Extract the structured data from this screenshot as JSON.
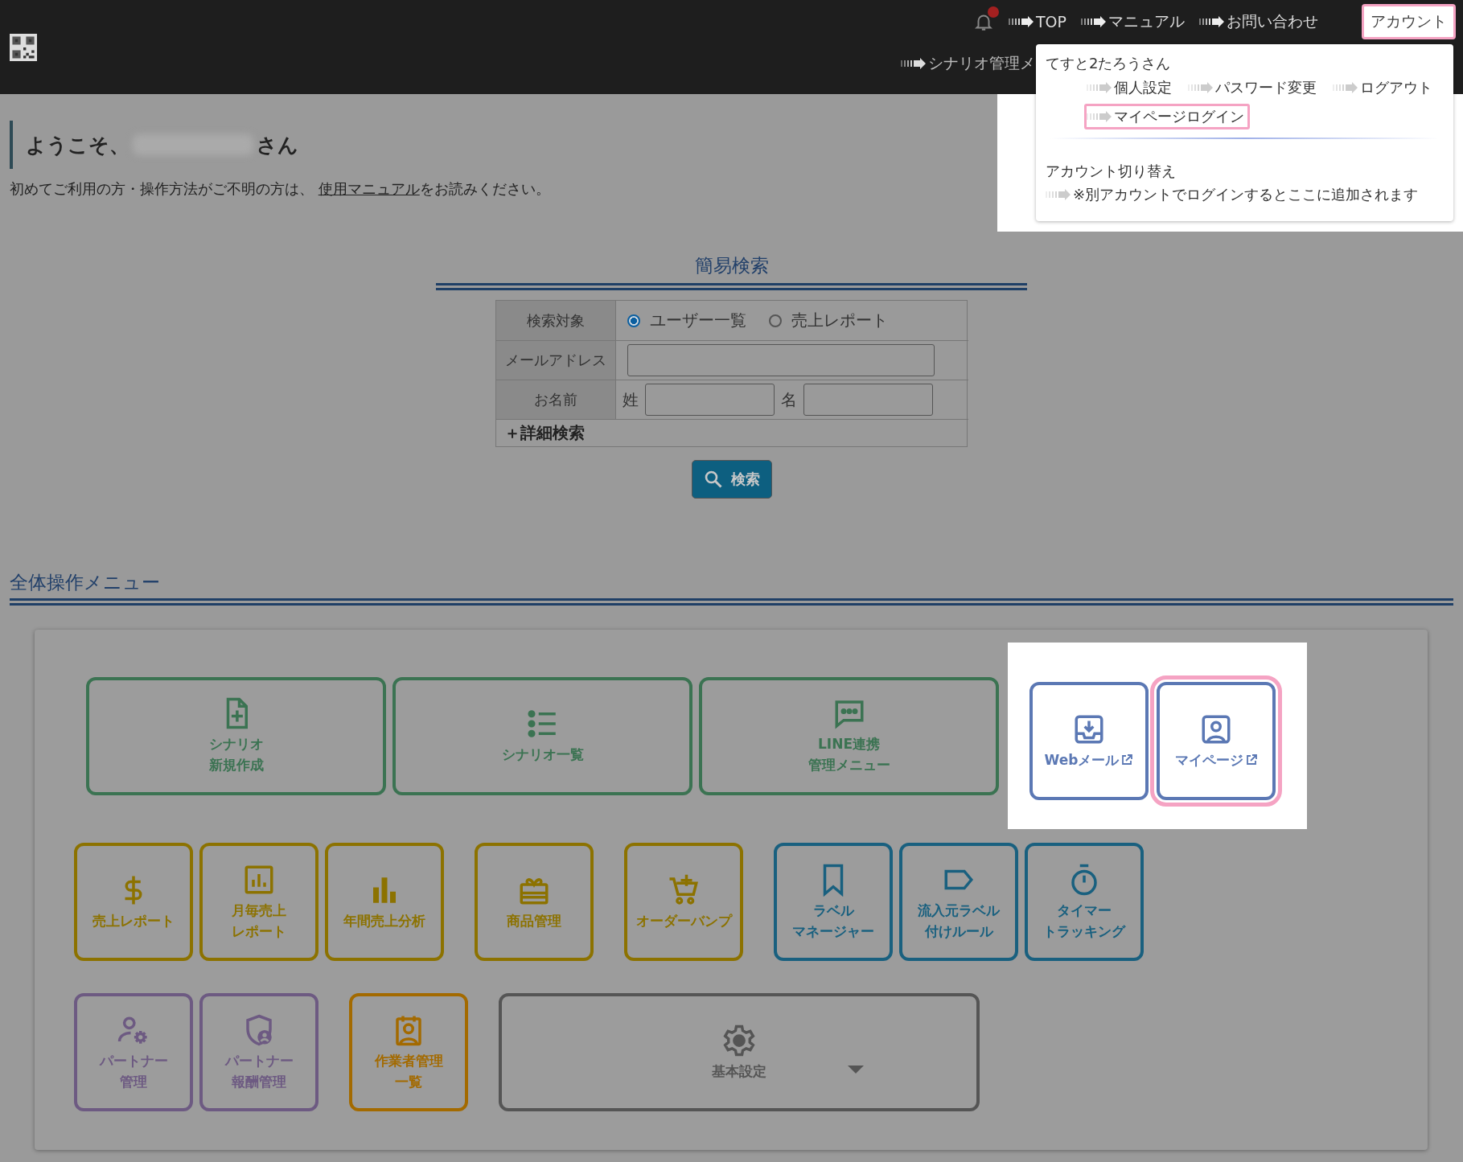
{
  "header": {
    "notification": {
      "unread": true
    },
    "nav": [
      {
        "label": "TOP"
      },
      {
        "label": "マニュアル"
      },
      {
        "label": "お問い合わせ"
      }
    ],
    "account_button": {
      "label": "アカウント",
      "highlighted": true
    },
    "sub_nav": [
      {
        "label": "シナリオ管理メ"
      }
    ]
  },
  "account_menu": {
    "user": "てすと2たろうさん",
    "links": [
      {
        "label": "個人設定",
        "highlighted": false
      },
      {
        "label": "パスワード変更",
        "highlighted": false
      },
      {
        "label": "ログアウト",
        "highlighted": false
      },
      {
        "label": "マイページログイン",
        "highlighted": true
      }
    ],
    "switch_title": "アカウント切り替え",
    "switch_note": "※別アカウントでログインするとここに追加されます"
  },
  "welcome": {
    "greeting": "ようこそ、",
    "suffix": "さん",
    "intro": "初めてご利用の方・操作方法がご不明の方は、",
    "intro_link": "使用マニュアル",
    "intro_end": "をお読みください。"
  },
  "search": {
    "title": "簡易検索",
    "target_label": "検索対象",
    "options": [
      {
        "label": "ユーザー一覧",
        "selected": true
      },
      {
        "label": "売上レポート",
        "selected": false
      }
    ],
    "email_label": "メールアドレス",
    "name_label": "お名前",
    "last_name_label": "姓",
    "first_name_label": "名",
    "advanced": "＋詳細検索",
    "button": "検索"
  },
  "menu": {
    "title": "全体操作メニュー",
    "rows": [
      {
        "groups": [
          {
            "color": "#3b7352",
            "spotlight": false,
            "tiles": [
              {
                "kind": "large",
                "lines": [
                  "シナリオ",
                  "新規作成"
                ]
              },
              {
                "kind": "large",
                "lines": [
                  "シナリオ一覧"
                ]
              },
              {
                "kind": "large",
                "lines": [
                  "LINE連携",
                  "管理メニュー"
                ]
              }
            ]
          },
          {
            "color": "#5b78b4",
            "spotlight": true,
            "tiles": [
              {
                "kind": "small",
                "lines": [
                  "Webメール"
                ],
                "external": true,
                "highlighted": false
              },
              {
                "kind": "small",
                "lines": [
                  "マイページ"
                ],
                "external": true,
                "highlighted": true
              }
            ]
          }
        ]
      },
      {
        "groups": [
          {
            "color": "#8c7200",
            "spotlight": false,
            "tiles": [
              {
                "kind": "small",
                "lines": [
                  "売上レポート"
                ]
              },
              {
                "kind": "small",
                "lines": [
                  "月毎売上",
                  "レポート"
                ]
              },
              {
                "kind": "small",
                "lines": [
                  "年間売上分析"
                ]
              }
            ]
          },
          {
            "color": "#8c7200",
            "spotlight": false,
            "tiles": [
              {
                "kind": "small",
                "lines": [
                  "商品管理"
                ]
              }
            ]
          },
          {
            "color": "#8c7200",
            "spotlight": false,
            "tiles": [
              {
                "kind": "small",
                "lines": [
                  "オーダーバンプ"
                ]
              }
            ]
          },
          {
            "color": "#19607f",
            "spotlight": false,
            "tiles": [
              {
                "kind": "small",
                "lines": [
                  "ラベル",
                  "マネージャー"
                ]
              },
              {
                "kind": "small",
                "lines": [
                  "流入元ラベル",
                  "付けルール"
                ]
              },
              {
                "kind": "small",
                "lines": [
                  "タイマー",
                  "トラッキング"
                ]
              }
            ]
          }
        ]
      },
      {
        "groups": [
          {
            "color": "#6d5a82",
            "spotlight": false,
            "tiles": [
              {
                "kind": "small",
                "lines": [
                  "パートナー",
                  "管理"
                ]
              },
              {
                "kind": "small",
                "lines": [
                  "パートナー",
                  "報酬管理"
                ]
              }
            ]
          },
          {
            "color": "#a36a00",
            "spotlight": false,
            "tiles": [
              {
                "kind": "small",
                "lines": [
                  "作業者管理",
                  "一覧"
                ]
              }
            ]
          },
          {
            "color": "#555555",
            "spotlight": false,
            "tiles": [
              {
                "kind": "wide",
                "lines": [
                  "基本設定"
                ],
                "has_dropdown": true
              }
            ]
          }
        ]
      }
    ]
  }
}
